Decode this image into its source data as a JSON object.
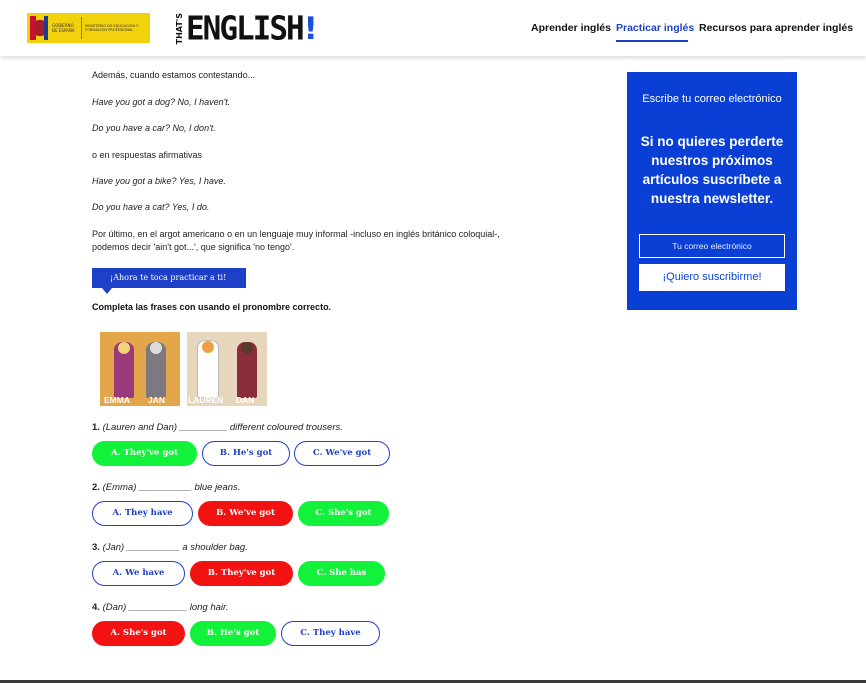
{
  "header": {
    "gov_logo": {
      "text": "GOBIERNO DE ESPAÑA",
      "ministry": "MINISTERIO DE EDUCACIÓN Y FORMACIÓN PROFESIONAL"
    },
    "brand": {
      "prefix": "THAT'S",
      "name": "ENGLISH",
      "mark": "!"
    },
    "nav": [
      {
        "label": "Aprender inglés",
        "active": false
      },
      {
        "label": "Practicar inglés",
        "active": true
      },
      {
        "label": "Recursos para aprender inglés",
        "active": false
      }
    ],
    "active_color": "#1e40c8"
  },
  "article": {
    "paragraphs": [
      "Además, cuando estamos contestando...",
      "Have you got a dog? No, I haven't.",
      "Do you have a car? No, I don't.",
      "o en respuestas afirmativas",
      "Have you got a bike? Yes, I have.",
      "Do you have a cat? Yes, I do.",
      "Por último, en el argot americano o en un lenguaje muy informal -incluso en inglés británico coloquial-,",
      "podemos decir 'ain't got...', que significa 'no tengo'."
    ],
    "practice_tag": "¡Ahora te toca practicar a ti!",
    "instruction": "Completa las frases con usando el pronombre correcto.",
    "image_labels": [
      "EMMA",
      "JAN",
      "LAUREN",
      "DAN"
    ]
  },
  "quiz": {
    "questions": [
      {
        "number": "1.",
        "text": "(Lauren and Dan) _________ different coloured trousers.",
        "options": [
          {
            "label": "A. They've got",
            "state": "correct"
          },
          {
            "label": "B. He's got",
            "state": "neutral"
          },
          {
            "label": "C. We've got",
            "state": "neutral"
          }
        ]
      },
      {
        "number": "2.",
        "text": "(Emma) __________ blue jeans.",
        "options": [
          {
            "label": "A. They have",
            "state": "neutral"
          },
          {
            "label": "B. We've got",
            "state": "wrong"
          },
          {
            "label": "C. She's got",
            "state": "correct"
          }
        ]
      },
      {
        "number": "3.",
        "text": "(Jan) __________ a shoulder bag.",
        "options": [
          {
            "label": "A. We have",
            "state": "neutral"
          },
          {
            "label": "B. They've got",
            "state": "wrong"
          },
          {
            "label": "C. She has",
            "state": "correct"
          }
        ]
      },
      {
        "number": "4.",
        "text": "(Dan) ___________ long hair.",
        "options": [
          {
            "label": "A. She's got",
            "state": "wrong"
          },
          {
            "label": "B. He's got",
            "state": "correct"
          },
          {
            "label": "C. They have",
            "state": "neutral"
          }
        ]
      }
    ],
    "colors": {
      "correct": "#12f23a",
      "wrong": "#f21212",
      "neutral": "#1e40c8"
    }
  },
  "newsletter": {
    "subtitle": "Escribe tu correo electrónico",
    "headline": "Si no quieres perderte nuestros próximos artículos suscríbete a nuestra newsletter.",
    "email_placeholder": "Tu correo electrónico",
    "subscribe_label": "¡Quiero suscribirme!",
    "background": "#0a3fd6"
  }
}
